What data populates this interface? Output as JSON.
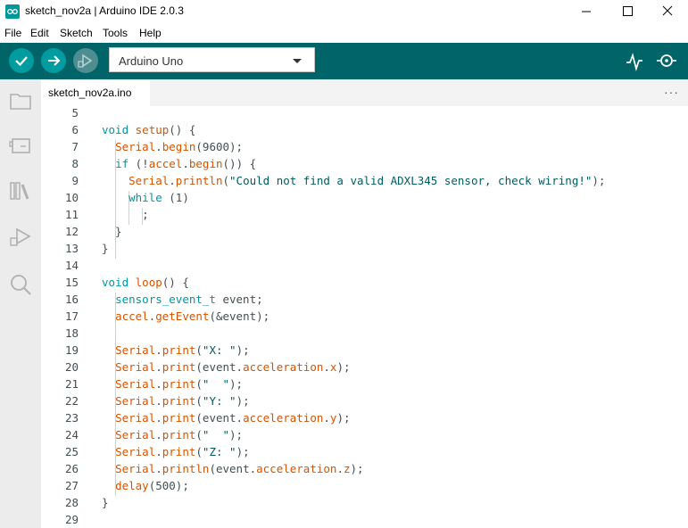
{
  "window": {
    "title": "sketch_nov2a | Arduino IDE 2.0.3",
    "controls": [
      "minimize-icon",
      "maximize-icon",
      "close-icon"
    ]
  },
  "menu": [
    "File",
    "Edit",
    "Sketch",
    "Tools",
    "Help"
  ],
  "toolbar": {
    "verify_icon": "checkmark-icon",
    "upload_icon": "arrow-right-icon",
    "debug_icon": "debug-icon",
    "board": "Arduino Uno",
    "right_icons": [
      "serial-plotter-icon",
      "serial-monitor-icon"
    ]
  },
  "sidebar": {
    "icons": [
      "folder-icon",
      "board-manager-icon",
      "library-icon",
      "debug-icon",
      "search-icon"
    ]
  },
  "tabs": [
    {
      "label": "sketch_nov2a.ino"
    }
  ],
  "tab_more": "···",
  "colors": {
    "toolbar": "#006468",
    "accent": "#00979c",
    "keyword": "#00979d",
    "function": "#d35400",
    "string": "#005c5f",
    "text": "#434f54"
  },
  "code_lines": [
    {
      "n": "5",
      "tokens": []
    },
    {
      "n": "6",
      "tokens": [
        [
          "kw",
          "void"
        ],
        [
          "t",
          " "
        ],
        [
          "fn",
          "setup"
        ],
        [
          "t",
          "() {"
        ]
      ]
    },
    {
      "n": "7",
      "tokens": [
        [
          "t",
          "  "
        ],
        [
          "fn",
          "Serial"
        ],
        [
          "t",
          "."
        ],
        [
          "fn",
          "begin"
        ],
        [
          "t",
          "(9600);"
        ]
      ]
    },
    {
      "n": "8",
      "tokens": [
        [
          "t",
          "  "
        ],
        [
          "kw",
          "if"
        ],
        [
          "t",
          " (!"
        ],
        [
          "fn",
          "accel"
        ],
        [
          "t",
          "."
        ],
        [
          "fn",
          "begin"
        ],
        [
          "t",
          "()) {"
        ]
      ]
    },
    {
      "n": "9",
      "tokens": [
        [
          "t",
          "    "
        ],
        [
          "fn",
          "Serial"
        ],
        [
          "t",
          "."
        ],
        [
          "fn",
          "println"
        ],
        [
          "t",
          "("
        ],
        [
          "str",
          "\"Could not find a valid ADXL345 sensor, check wiring!\""
        ],
        [
          "t",
          ");"
        ]
      ]
    },
    {
      "n": "10",
      "tokens": [
        [
          "t",
          "    "
        ],
        [
          "kw",
          "while"
        ],
        [
          "t",
          " (1)"
        ]
      ]
    },
    {
      "n": "11",
      "tokens": [
        [
          "t",
          "      ;"
        ]
      ]
    },
    {
      "n": "12",
      "tokens": [
        [
          "t",
          "  }"
        ]
      ]
    },
    {
      "n": "13",
      "tokens": [
        [
          "t",
          "}"
        ]
      ]
    },
    {
      "n": "14",
      "tokens": []
    },
    {
      "n": "15",
      "tokens": [
        [
          "kw",
          "void"
        ],
        [
          "t",
          " "
        ],
        [
          "fn",
          "loop"
        ],
        [
          "t",
          "() {"
        ]
      ]
    },
    {
      "n": "16",
      "tokens": [
        [
          "t",
          "  "
        ],
        [
          "kw",
          "sensors_event_t"
        ],
        [
          "t",
          " event;"
        ]
      ]
    },
    {
      "n": "17",
      "tokens": [
        [
          "t",
          "  "
        ],
        [
          "fn",
          "accel"
        ],
        [
          "t",
          "."
        ],
        [
          "fn",
          "getEvent"
        ],
        [
          "t",
          "(&event);"
        ]
      ]
    },
    {
      "n": "18",
      "tokens": []
    },
    {
      "n": "19",
      "tokens": [
        [
          "t",
          "  "
        ],
        [
          "fn",
          "Serial"
        ],
        [
          "t",
          "."
        ],
        [
          "fn",
          "print"
        ],
        [
          "t",
          "("
        ],
        [
          "str",
          "\"X: \""
        ],
        [
          "t",
          ");"
        ]
      ]
    },
    {
      "n": "20",
      "tokens": [
        [
          "t",
          "  "
        ],
        [
          "fn",
          "Serial"
        ],
        [
          "t",
          "."
        ],
        [
          "fn",
          "print"
        ],
        [
          "t",
          "(event."
        ],
        [
          "fn",
          "acceleration"
        ],
        [
          "t",
          "."
        ],
        [
          "fn",
          "x"
        ],
        [
          "t",
          ");"
        ]
      ]
    },
    {
      "n": "21",
      "tokens": [
        [
          "t",
          "  "
        ],
        [
          "fn",
          "Serial"
        ],
        [
          "t",
          "."
        ],
        [
          "fn",
          "print"
        ],
        [
          "t",
          "("
        ],
        [
          "str",
          "\"  \""
        ],
        [
          "t",
          ");"
        ]
      ]
    },
    {
      "n": "22",
      "tokens": [
        [
          "t",
          "  "
        ],
        [
          "fn",
          "Serial"
        ],
        [
          "t",
          "."
        ],
        [
          "fn",
          "print"
        ],
        [
          "t",
          "("
        ],
        [
          "str",
          "\"Y: \""
        ],
        [
          "t",
          ");"
        ]
      ]
    },
    {
      "n": "23",
      "tokens": [
        [
          "t",
          "  "
        ],
        [
          "fn",
          "Serial"
        ],
        [
          "t",
          "."
        ],
        [
          "fn",
          "print"
        ],
        [
          "t",
          "(event."
        ],
        [
          "fn",
          "acceleration"
        ],
        [
          "t",
          "."
        ],
        [
          "fn",
          "y"
        ],
        [
          "t",
          ");"
        ]
      ]
    },
    {
      "n": "24",
      "tokens": [
        [
          "t",
          "  "
        ],
        [
          "fn",
          "Serial"
        ],
        [
          "t",
          "."
        ],
        [
          "fn",
          "print"
        ],
        [
          "t",
          "("
        ],
        [
          "str",
          "\"  \""
        ],
        [
          "t",
          ");"
        ]
      ]
    },
    {
      "n": "25",
      "tokens": [
        [
          "t",
          "  "
        ],
        [
          "fn",
          "Serial"
        ],
        [
          "t",
          "."
        ],
        [
          "fn",
          "print"
        ],
        [
          "t",
          "("
        ],
        [
          "str",
          "\"Z: \""
        ],
        [
          "t",
          ");"
        ]
      ]
    },
    {
      "n": "26",
      "tokens": [
        [
          "t",
          "  "
        ],
        [
          "fn",
          "Serial"
        ],
        [
          "t",
          "."
        ],
        [
          "fn",
          "println"
        ],
        [
          "t",
          "(event."
        ],
        [
          "fn",
          "acceleration"
        ],
        [
          "t",
          "."
        ],
        [
          "fn",
          "z"
        ],
        [
          "t",
          ");"
        ]
      ]
    },
    {
      "n": "27",
      "tokens": [
        [
          "t",
          "  "
        ],
        [
          "fn",
          "delay"
        ],
        [
          "t",
          "(500);"
        ]
      ]
    },
    {
      "n": "28",
      "tokens": [
        [
          "t",
          "}"
        ]
      ]
    },
    {
      "n": "29",
      "tokens": []
    }
  ]
}
